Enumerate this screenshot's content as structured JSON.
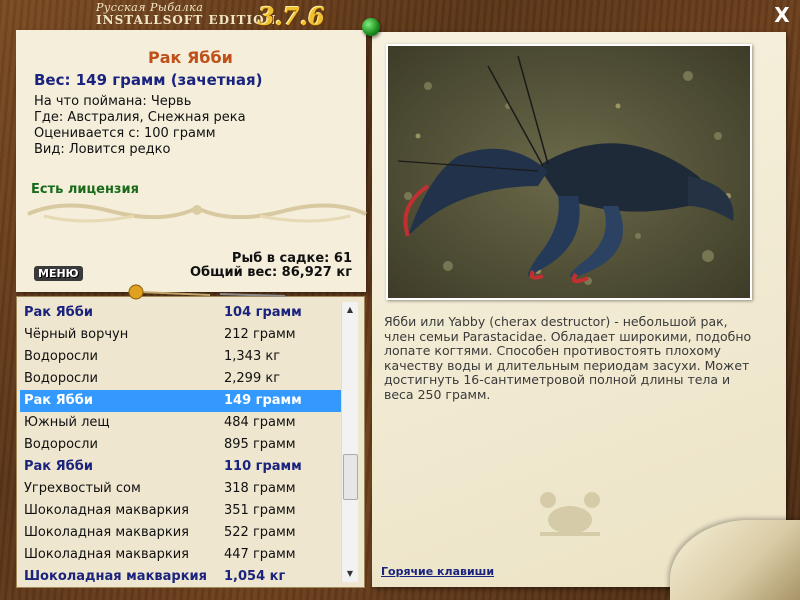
{
  "window": {
    "title_line1": "Русская Рыбалка",
    "title_line2": "INSTALLSOFT EDITION",
    "version": "3.7.6",
    "close_label": "X"
  },
  "fish": {
    "name": "Рак Ябби",
    "weight": "Вес: 149 грамм (зачетная)",
    "caught_on": "На что поймана: Червь",
    "location": "Где: Австралия, Снежная река",
    "rated_from": "Оценивается с: 100 грамм",
    "kind": "Вид: Ловится редко",
    "license": "Есть лицензия"
  },
  "stats": {
    "in_cage": "Рыб в садке: 61",
    "total_weight": "Общий вес: 86,927 кг"
  },
  "menu_label": "МЕНЮ",
  "catch_list": [
    {
      "name": "Рак Ябби",
      "weight": "104 грамм",
      "style": "bold"
    },
    {
      "name": "Чёрный ворчун",
      "weight": "212 грамм",
      "style": "normal"
    },
    {
      "name": "Водоросли",
      "weight": "1,343 кг",
      "style": "normal"
    },
    {
      "name": "Водоросли",
      "weight": "2,299 кг",
      "style": "normal"
    },
    {
      "name": "Рак Ябби",
      "weight": "149 грамм",
      "style": "selected"
    },
    {
      "name": "Южный лещ",
      "weight": "484 грамм",
      "style": "normal"
    },
    {
      "name": "Водоросли",
      "weight": "895 грамм",
      "style": "normal"
    },
    {
      "name": "Рак Ябби",
      "weight": "110 грамм",
      "style": "bold"
    },
    {
      "name": "Угрехвостый сом",
      "weight": "318 грамм",
      "style": "normal"
    },
    {
      "name": "Шоколадная макваркия",
      "weight": "351 грамм",
      "style": "normal"
    },
    {
      "name": "Шоколадная макваркия",
      "weight": "522 грамм",
      "style": "normal"
    },
    {
      "name": "Шоколадная макваркия",
      "weight": "447 грамм",
      "style": "normal"
    },
    {
      "name": "Шоколадная макваркия",
      "weight": "1,054 кг",
      "style": "bold"
    }
  ],
  "description": "Ябби или Yabby (cherax destructor) - небольшой рак, член семьи Parastacidae. Обладает широкими, подобно лопате когтями. Способен противостоять плохому качеству воды и длительным периодам засухи. Может достигнуть 16-сантиметровой полной длины тела и веса 250 грамм.",
  "hotkeys_label": "Горячие клавиши",
  "colors": {
    "selection": "#3399ff",
    "highlight_text": "#1a237e",
    "fish_name": "#c0501a",
    "license": "#1a6a1a"
  }
}
